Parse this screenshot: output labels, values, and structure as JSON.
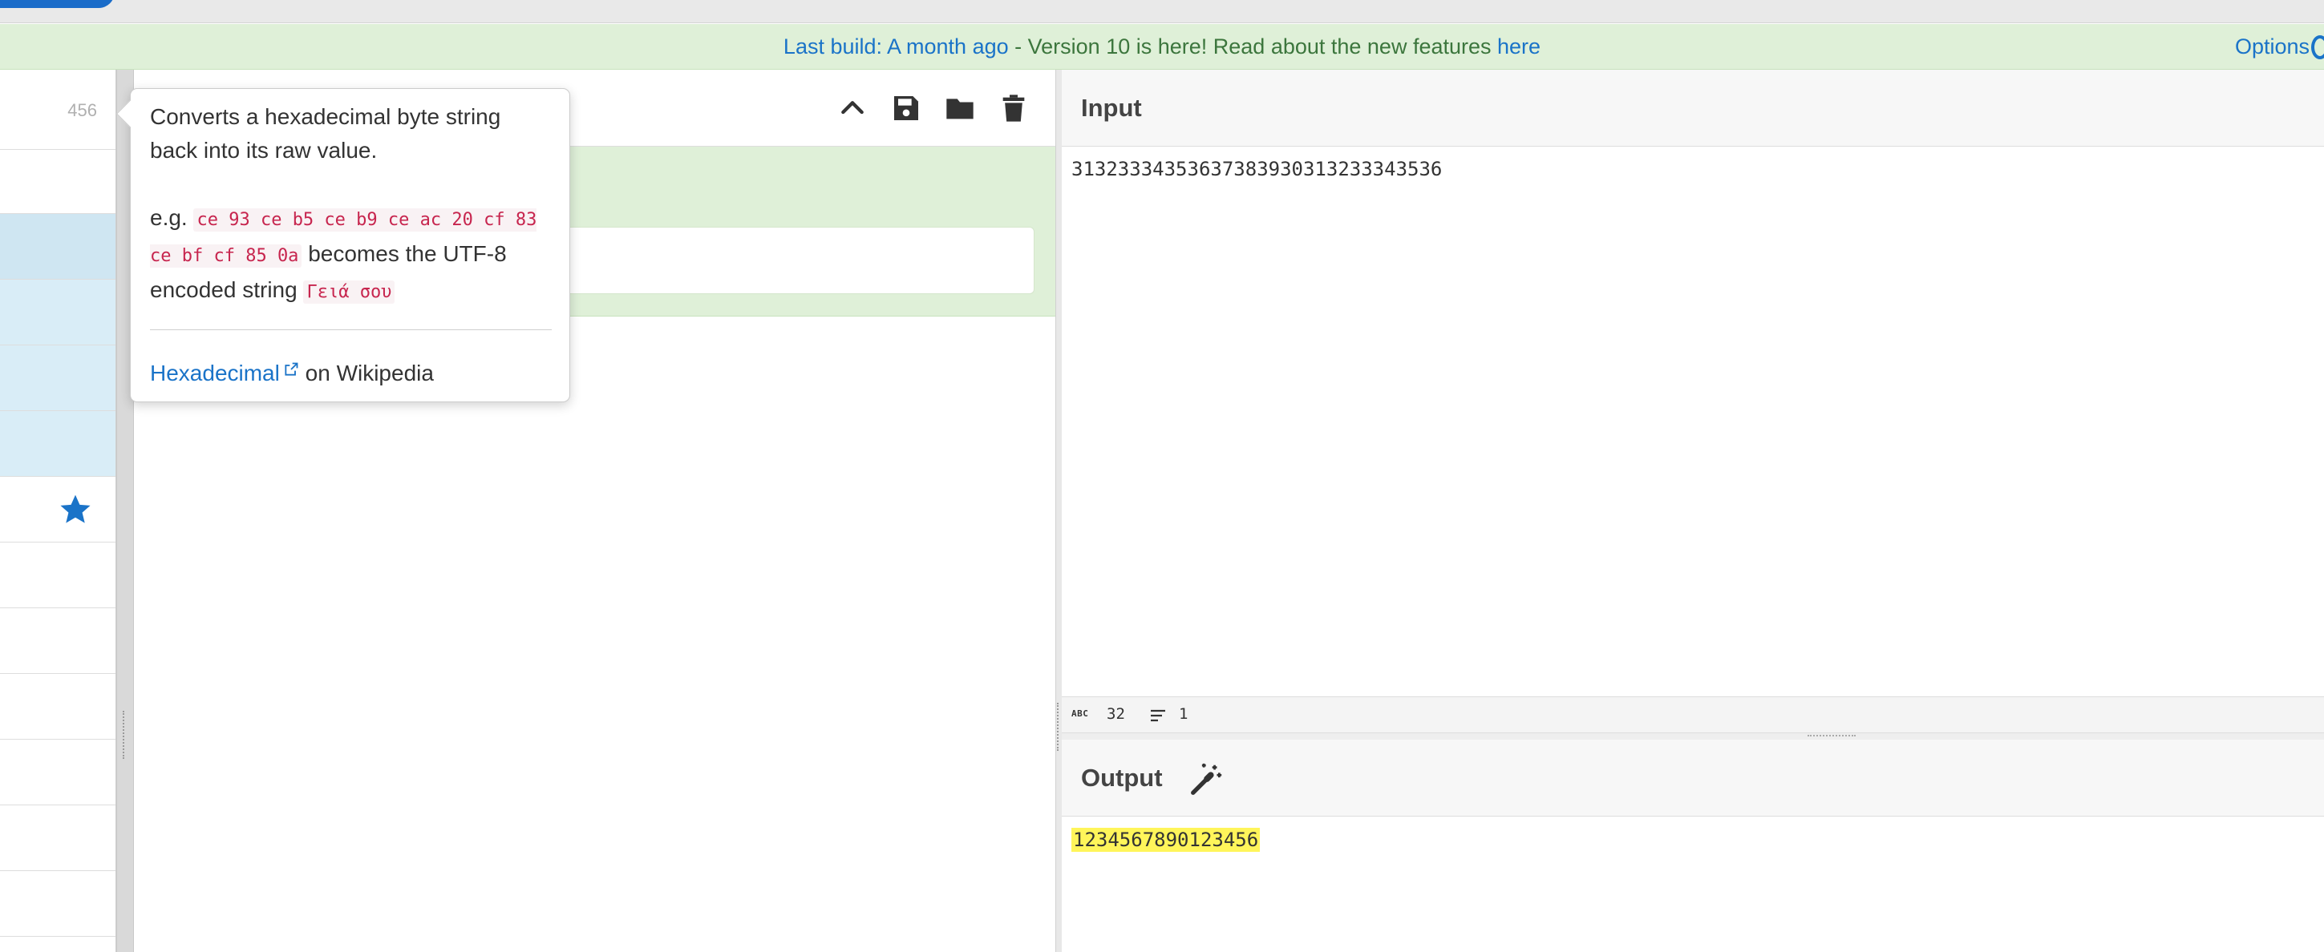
{
  "notice": {
    "prefix": "Last build: A month ago",
    "middle": " - Version 10 is here! Read about the new features ",
    "link": "here",
    "options_label": "Options"
  },
  "operations": {
    "count": "456"
  },
  "tooltip": {
    "description": "Converts a hexadecimal byte string back into its raw value.",
    "example_prefix": "e.g. ",
    "example_input": "ce 93 ce b5 ce b9 ce ac 20 cf 83 ce bf cf 85 0a",
    "example_middle": " becomes the UTF-8 encoded string ",
    "example_output": "Γειά σου",
    "link_text": "Hexadecimal",
    "link_suffix": " on Wikipedia"
  },
  "input": {
    "title": "Input",
    "value": "31323334353637383930313233343536",
    "stats": {
      "abc_label": "ABC",
      "length": "32",
      "lines": "1"
    }
  },
  "output": {
    "title": "Output",
    "value": "1234567890123456"
  },
  "icons": {
    "star": "star-icon",
    "collapse": "chevron-up-icon",
    "save": "save-icon",
    "folder": "folder-icon",
    "trash": "trash-icon",
    "disable": "disable-icon",
    "pause": "pause-icon",
    "wand": "magic-wand-icon",
    "external": "external-link-icon"
  },
  "colors": {
    "accent": "#1a73c8",
    "notice_bg": "#dff0d8",
    "highlight": "#fff55a"
  }
}
